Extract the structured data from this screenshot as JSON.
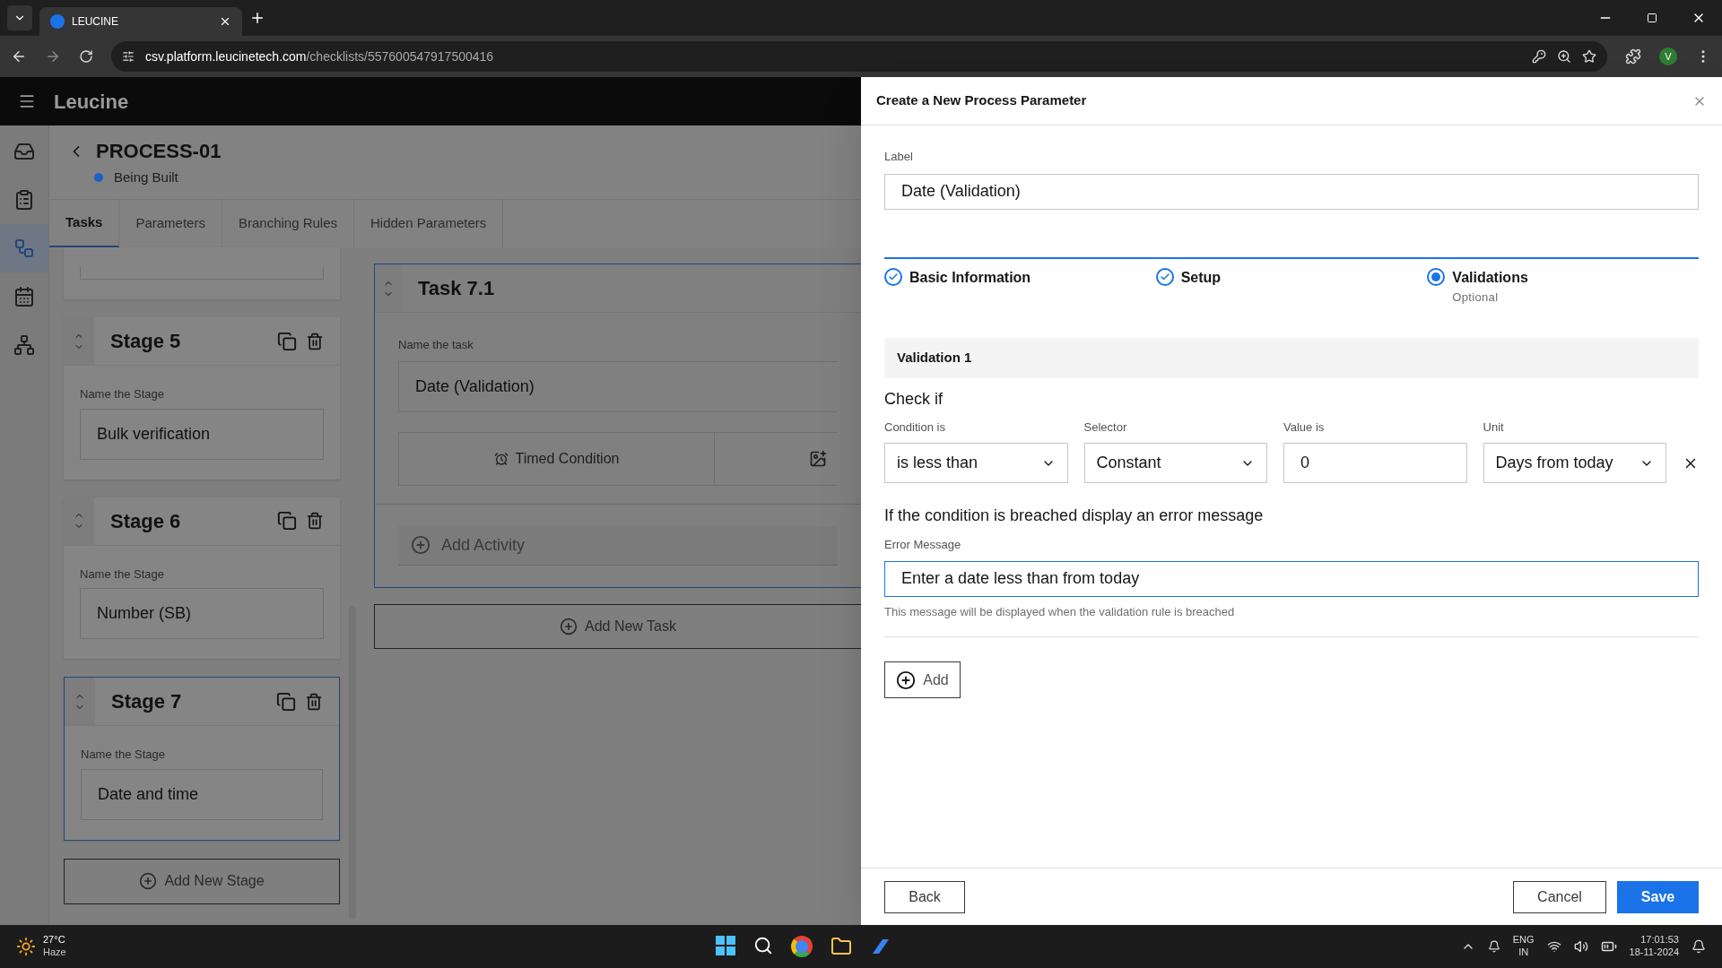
{
  "browser": {
    "tab_title": "LEUCINE",
    "url_host": "csv.platform.leucinetech.com",
    "url_path": "/checklists/557600547917500416",
    "profile": "V"
  },
  "app": {
    "brand": "Leucine",
    "sidebar": [
      {
        "selected": false
      },
      {
        "selected": false
      },
      {
        "selected": true
      },
      {
        "selected": false
      },
      {
        "selected": false
      }
    ]
  },
  "process": {
    "title": "PROCESS-01",
    "status": "Being Built"
  },
  "tabs": [
    {
      "label": "Tasks",
      "selected": true
    },
    {
      "label": "Parameters",
      "selected": false
    },
    {
      "label": "Branching Rules",
      "selected": false
    },
    {
      "label": "Hidden Parameters",
      "selected": false
    }
  ],
  "stages": [
    {
      "title": "Stage 5",
      "field_label": "Name the Stage",
      "value": "Bulk verification",
      "selected": false
    },
    {
      "title": "Stage 6",
      "field_label": "Name the Stage",
      "value": "Number (SB)",
      "selected": false
    },
    {
      "title": "Stage 7",
      "field_label": "Name the Stage",
      "value": "Date and time",
      "selected": true
    }
  ],
  "add_stage": "Add New Stage",
  "task": {
    "title": "Task 7.1",
    "field_label": "Name the task",
    "value": "Date (Validation)",
    "timed": "Timed Condition",
    "add_activity": "Add Activity"
  },
  "add_task": "Add New Task",
  "drawer": {
    "title": "Create a New Process Parameter",
    "label_caption": "Label",
    "label_value": "Date (Validation)",
    "steps": [
      {
        "label": "Basic Information",
        "kind": "done"
      },
      {
        "label": "Setup",
        "kind": "done"
      },
      {
        "label": "Validations",
        "kind": "current",
        "note": "Optional"
      }
    ],
    "validation": {
      "title": "Validation 1",
      "check_if": "Check if",
      "fields": [
        {
          "caption": "Condition is",
          "value": "is less than",
          "kind": "select"
        },
        {
          "caption": "Selector",
          "value": "Constant",
          "kind": "select"
        },
        {
          "caption": "Value is",
          "value": "0",
          "kind": "input"
        },
        {
          "caption": "Unit",
          "value": "Days from today",
          "kind": "select"
        }
      ],
      "error_heading": "If the condition is breached display an error message",
      "error_caption": "Error Message",
      "error_value": "Enter a date less than from today",
      "error_help": "This message will be displayed when the validation rule is breached"
    },
    "add": "Add",
    "back": "Back",
    "cancel": "Cancel",
    "save": "Save"
  },
  "taskbar": {
    "temp": "27°C",
    "weather": "Haze",
    "lang1": "ENG",
    "lang2": "IN",
    "time": "17:01:53",
    "date": "18-11-2024"
  }
}
